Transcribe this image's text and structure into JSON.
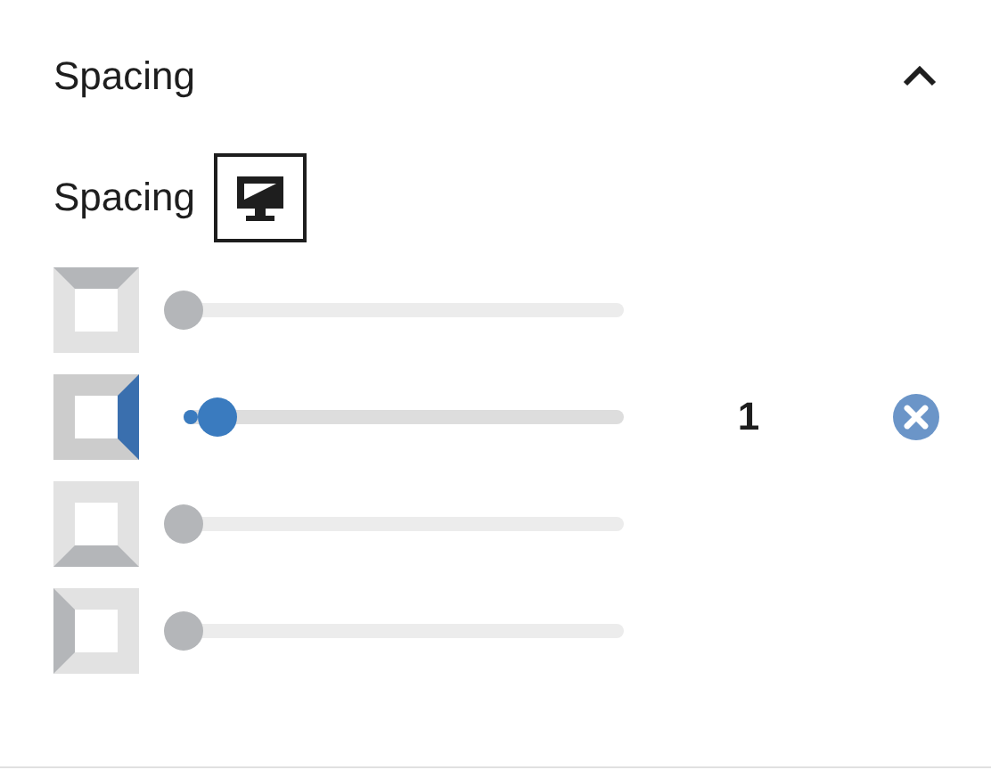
{
  "panel": {
    "title": "Spacing",
    "expanded": true
  },
  "control": {
    "label": "Spacing",
    "device_selected": true
  },
  "rows": [
    {
      "kind": "top",
      "active": false,
      "level": 0
    },
    {
      "kind": "right",
      "active": true,
      "level": 0.08,
      "value": "1",
      "clearable": true
    },
    {
      "kind": "bottom",
      "active": false,
      "level": 0
    },
    {
      "kind": "left",
      "active": false,
      "level": 0
    }
  ]
}
